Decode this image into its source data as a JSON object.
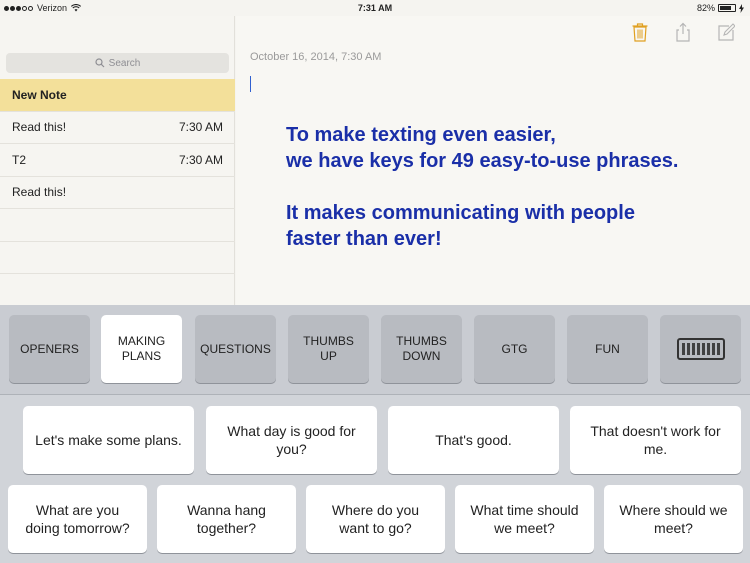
{
  "status_bar": {
    "carrier": "Verizon",
    "time": "7:31 AM",
    "battery": "82%",
    "battery_level": 0.82
  },
  "sidebar": {
    "search_placeholder": "Search",
    "notes": [
      {
        "title": "New Note",
        "time": ""
      },
      {
        "title": "Read this!",
        "time": "7:30 AM"
      },
      {
        "title": "T2",
        "time": "7:30 AM"
      },
      {
        "title": "Read this!",
        "time": ""
      }
    ]
  },
  "note": {
    "date": "October 16, 2014, 7:30 AM",
    "line1": "To make texting even easier,",
    "line2": "we have keys for 49 easy-to-use phrases.",
    "line3": "It makes communicating with people",
    "line4": "faster than ever!"
  },
  "keyboard": {
    "categories": [
      {
        "label": "OPENERS"
      },
      {
        "label": "MAKING\nPLANS"
      },
      {
        "label": "QUESTIONS"
      },
      {
        "label": "THUMBS\nUP"
      },
      {
        "label": "THUMBS\nDOWN"
      },
      {
        "label": "GTG"
      },
      {
        "label": "FUN"
      }
    ],
    "phrases_row1": [
      {
        "label": "Let's make some plans."
      },
      {
        "label": "What day is good for\nyou?"
      },
      {
        "label": "That's good."
      },
      {
        "label": "That doesn't work for\nme."
      }
    ],
    "phrases_row2": [
      {
        "label": "What are you\ndoing tomorrow?"
      },
      {
        "label": "Wanna hang\ntogether?"
      },
      {
        "label": "Where do you\nwant to go?"
      },
      {
        "label": "What time should\nwe meet?"
      },
      {
        "label": "Where should we\nmeet?"
      }
    ]
  },
  "colors": {
    "note_text": "#1a2fa8",
    "selected_row": "#f3e09a",
    "trash_icon": "#e0a020"
  }
}
